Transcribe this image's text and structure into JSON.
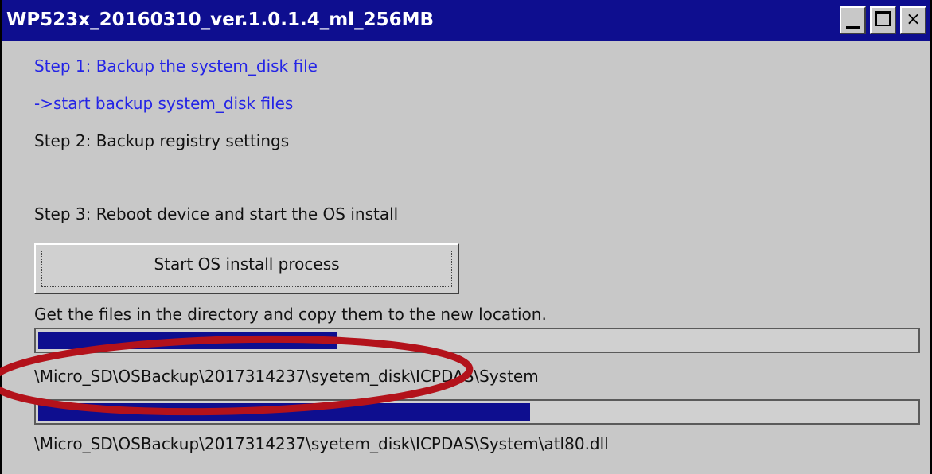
{
  "window": {
    "title": "WP523x_20160310_ver.1.0.1.4_ml_256MB",
    "close_glyph": "×"
  },
  "steps": {
    "step1": "Step 1: Backup the system_disk file",
    "step1_sub": "->start backup system_disk files",
    "step2": "Step 2: Backup registry settings",
    "step3": "Step 3: Reboot device and start the OS install"
  },
  "actions": {
    "start_button_label": "Start OS install process"
  },
  "status": {
    "message": "Get the files in the directory and copy them to the new location.",
    "folder_progress": 0.34,
    "current_folder": "\\Micro_SD\\OSBackup\\2017314237\\syetem_disk\\ICPDAS\\System",
    "file_progress": 0.56,
    "current_file": "\\Micro_SD\\OSBackup\\2017314237\\syetem_disk\\ICPDAS\\System\\atl80.dll"
  },
  "colors": {
    "titlebar": "#0e0e8f",
    "progress_fill": "#0e0e8f",
    "link_text": "#2424e6",
    "annotation_ellipse": "#b3121b"
  },
  "icons": {
    "minimize": "minimize-icon",
    "maximize": "maximize-icon",
    "close": "close-icon"
  }
}
